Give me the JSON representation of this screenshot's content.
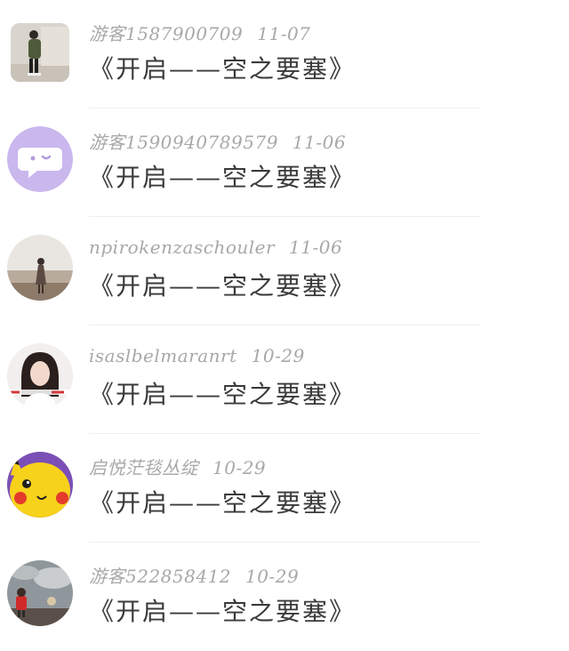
{
  "comments": [
    {
      "user": "游客1587900709",
      "time": "11-07",
      "text": "《开启——空之要塞》",
      "avatar_icon": "person-photo-avatar"
    },
    {
      "user": "游客1590940789579",
      "time": "11-06",
      "text": "《开启——空之要塞》",
      "avatar_icon": "chat-bubble-avatar"
    },
    {
      "user": "npirokenzaschouler",
      "time": "11-06",
      "text": "《开启——空之要塞》",
      "avatar_icon": "girl-field-avatar"
    },
    {
      "user": "isaslbelmaranrt",
      "time": "10-29",
      "text": "《开启——空之要塞》",
      "avatar_icon": "girl-portrait-avatar"
    },
    {
      "user": "启悦茫毯丛绽",
      "time": "10-29",
      "text": "《开启——空之要塞》",
      "avatar_icon": "pikachu-avatar"
    },
    {
      "user": "游客522858412",
      "time": "10-29",
      "text": "《开启——空之要塞》",
      "avatar_icon": "child-cloud-avatar"
    }
  ],
  "colors": {
    "username": "#a8a8a8",
    "message": "#3a3a3a",
    "divider": "#efefef",
    "chat_avatar_bg": "#c9b7ee"
  }
}
